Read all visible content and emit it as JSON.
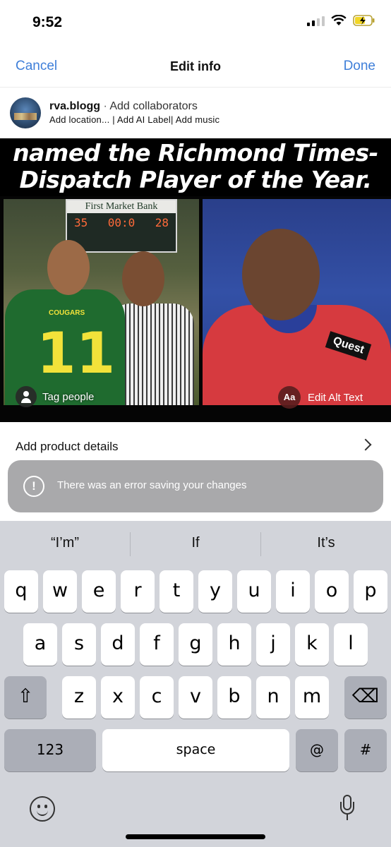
{
  "status_bar": {
    "time": "9:52",
    "icons": [
      "signal-icon",
      "wifi-icon",
      "battery-charging-icon"
    ]
  },
  "nav": {
    "cancel_label": "Cancel",
    "title": "Edit info",
    "done_label": "Done",
    "accent_color": "#3f7fd9"
  },
  "user": {
    "username": "rva.blogg",
    "separator": "·",
    "collaborators_label": "Add collaborators",
    "add_location": "Add location...",
    "add_ai_label": "Add AI Label",
    "add_music": "Add music",
    "divider": "|"
  },
  "post": {
    "headline_line1": "named the Richmond Times-",
    "headline_line2": "Dispatch Player of the Year.",
    "scoreboard_brand": "First Market Bank",
    "scoreboard_home": "35",
    "scoreboard_clock": "00:0",
    "scoreboard_guest": "28",
    "jersey_number": "11",
    "jersey_team": "COUGARS",
    "sponsor_patch": "Quest",
    "tag_people_label": "Tag people",
    "alt_icon_label": "Aa",
    "edit_alt_label": "Edit Alt Text"
  },
  "product_details_label": "Add product details",
  "toast": {
    "icon": "!",
    "message": "There was an error saving your changes"
  },
  "keyboard": {
    "suggestions": [
      "“I’m”",
      "If",
      "It’s"
    ],
    "row1": [
      "q",
      "w",
      "e",
      "r",
      "t",
      "y",
      "u",
      "i",
      "o",
      "p"
    ],
    "row2": [
      "a",
      "s",
      "d",
      "f",
      "g",
      "h",
      "j",
      "k",
      "l"
    ],
    "row3": [
      "z",
      "x",
      "c",
      "v",
      "b",
      "n",
      "m"
    ],
    "shift_symbol": "⇧",
    "delete_symbol": "⌫",
    "numbers_label": "123",
    "space_label": "space",
    "at_label": "@",
    "hash_label": "#"
  }
}
